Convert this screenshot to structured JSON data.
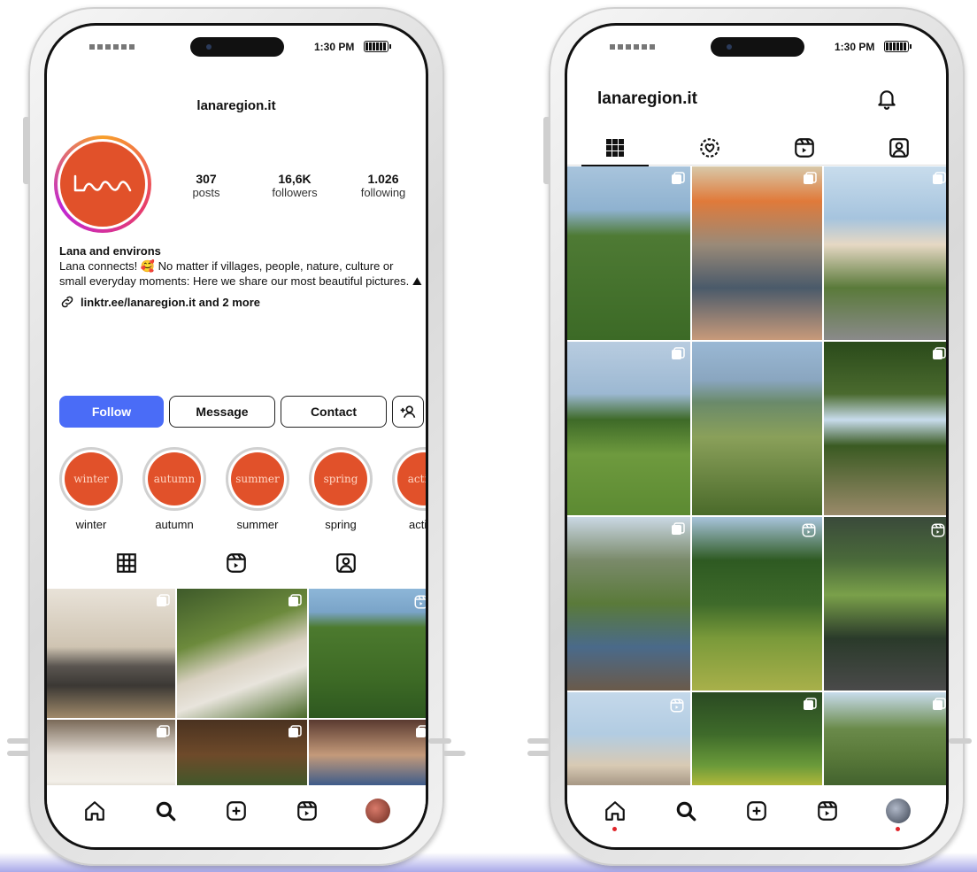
{
  "status": {
    "time": "1:30 PM"
  },
  "left": {
    "username": "lanaregion.it",
    "avatar_logo": "lana",
    "stats": [
      {
        "num": "307",
        "label": "posts"
      },
      {
        "num": "16,6K",
        "label": "followers"
      },
      {
        "num": "1.026",
        "label": "following"
      }
    ],
    "bio": {
      "name": "Lana and environs",
      "line1": "Lana connects! 🥰 No matter if villages, people, nature, culture or small everyday moments: Here we share our most beautiful pictures. ⛰",
      "link": "linktr.ee/lanaregion.it and 2 more"
    },
    "buttons": {
      "follow": "Follow",
      "message": "Message",
      "contact": "Contact"
    },
    "highlights": [
      {
        "label": "winter",
        "text": "winter"
      },
      {
        "label": "autumn",
        "text": "autumn"
      },
      {
        "label": "summer",
        "text": "summer"
      },
      {
        "label": "spring",
        "text": "spring"
      },
      {
        "label": "active",
        "text": "active"
      }
    ]
  },
  "right": {
    "username": "lanaregion.it"
  },
  "icons": {
    "nav": [
      "home-icon",
      "search-icon",
      "add-post-icon",
      "reels-icon",
      "profile-avatar"
    ],
    "tabs": [
      "grid-icon",
      "reels-icon",
      "tagged-icon"
    ]
  },
  "colors": {
    "brand_orange": "#e1512a",
    "follow_blue": "#4a6cf7",
    "notification_dot": "#e0242a"
  }
}
